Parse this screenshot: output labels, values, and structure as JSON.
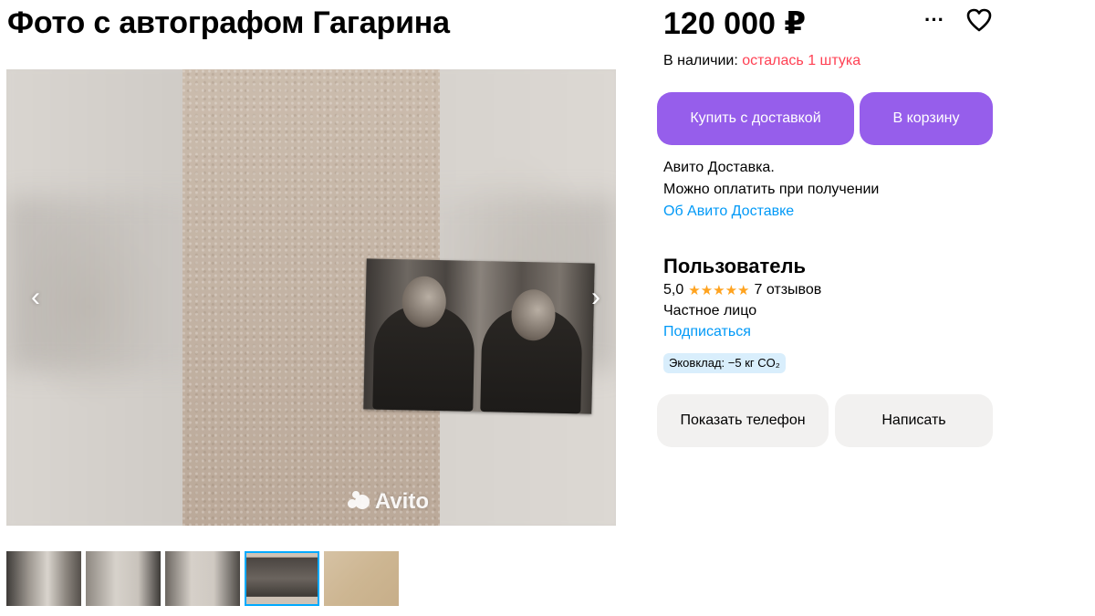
{
  "listing": {
    "title": "Фото с автографом Гагарина",
    "watermark": "Avito",
    "thumbnails_count": 5,
    "selected_thumbnail_index": 4
  },
  "price": "120 000 ₽",
  "stock": {
    "label": "В наличии:",
    "value": "осталась 1 штука",
    "value_color": "#ff4053"
  },
  "actions": {
    "buy_label": "Купить с доставкой",
    "cart_label": "В корзину",
    "primary_color": "#965eeb"
  },
  "delivery": {
    "line1": "Авито Доставка.",
    "line2": "Можно оплатить при получении",
    "link": "Об Авито Доставке"
  },
  "seller": {
    "name": "Пользователь",
    "rating": "5,0",
    "stars": "★★★★★",
    "reviews": "7 отзывов",
    "type": "Частное лицо",
    "subscribe": "Подписаться",
    "eco_badge": "Эковклад: −5 кг CO₂"
  },
  "contact": {
    "phone_label": "Показать телефон",
    "message_label": "Написать"
  },
  "icons": {
    "more": "more-dots-icon",
    "favorite": "heart-icon",
    "prev": "chevron-left-icon",
    "next": "chevron-right-icon"
  },
  "arrows": {
    "prev": "‹",
    "next": "›",
    "more": "···"
  }
}
